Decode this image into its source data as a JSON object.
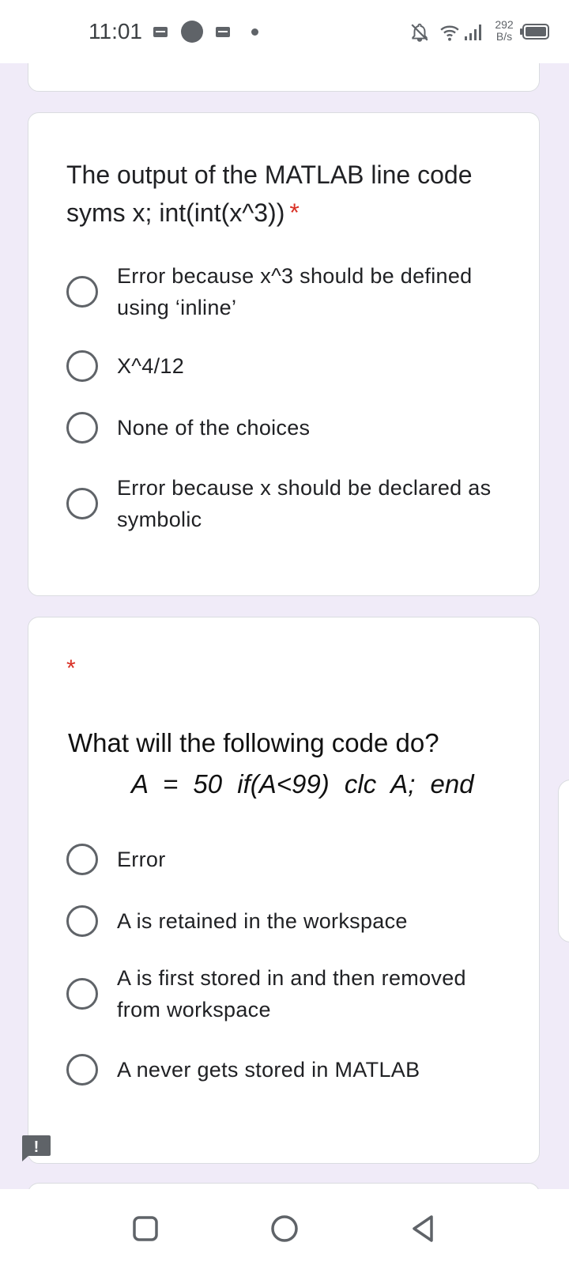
{
  "status_bar": {
    "time": "11:01",
    "net_speed_value": "292",
    "net_speed_unit": "B/s",
    "icons": [
      "message-icon",
      "circle-notification-icon",
      "message-icon",
      "dot-icon",
      "bell-off-icon",
      "wifi-icon",
      "signal-icon",
      "battery-icon"
    ]
  },
  "question1": {
    "title_line1": "The output of the MATLAB line code",
    "title_line2": "syms x; int(int(x^3))",
    "required_marker": "*",
    "options": [
      {
        "label": "Error because x^3 should be defined using ‘inline’"
      },
      {
        "label": "X^4/12"
      },
      {
        "label": "None of the choices"
      },
      {
        "label": "Error because x should be declared as symbolic"
      }
    ]
  },
  "question2": {
    "required_marker": "*",
    "image_text_line1": "What will the following code do?",
    "image_text_line2": "A = 50  if(A<99)  clc A;  end",
    "options": [
      {
        "label": "Error"
      },
      {
        "label": "A is retained in the workspace"
      },
      {
        "label": "A is first stored in and then removed from workspace"
      },
      {
        "label": "A never gets stored in MATLAB"
      }
    ]
  },
  "report_badge": {
    "icon": "report-icon",
    "text": "!"
  },
  "nav_bar": {
    "icons": [
      "recent-apps-icon",
      "home-icon",
      "back-icon"
    ]
  },
  "colors": {
    "background": "#f0ebf8",
    "required": "#d93025",
    "radio": "#5f6368"
  }
}
